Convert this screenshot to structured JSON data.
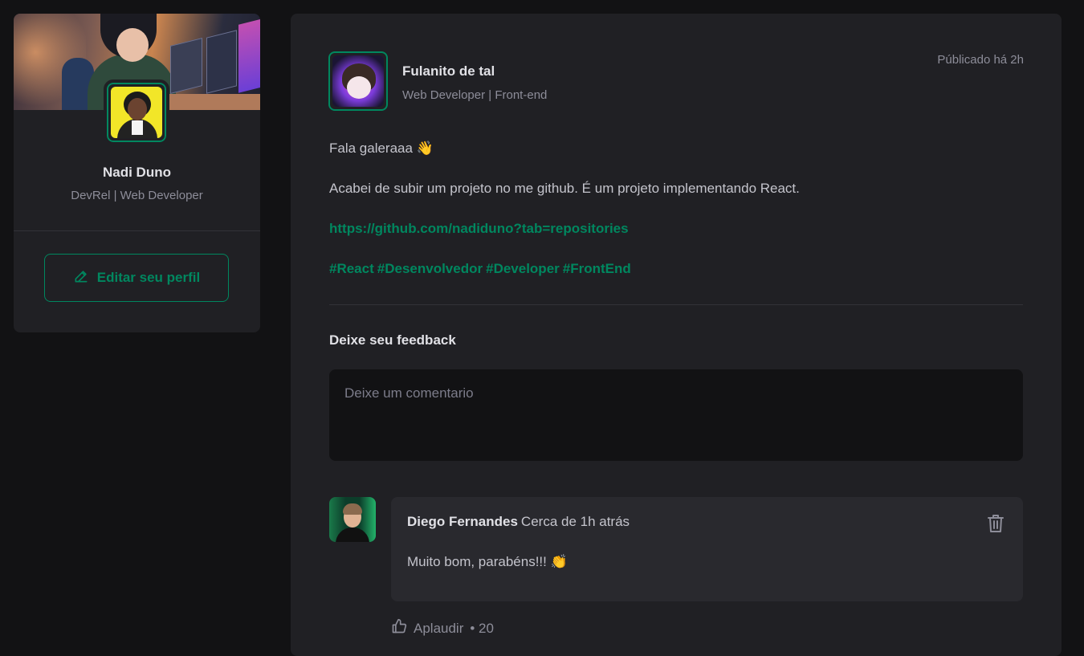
{
  "profile": {
    "name": "Nadi Duno",
    "role": "DevRel | Web Developer",
    "edit_label": "Editar seu perfil"
  },
  "post": {
    "author": {
      "name": "Fulanito de tal",
      "role": "Web Developer | Front-end"
    },
    "published": "Públicado há 2h",
    "content": {
      "greeting": "Fala galeraaa 👋",
      "body": "Acabei de subir um projeto no me github. É um projeto implementando React.",
      "link": "https://github.com/nadiduno?tab=repositories",
      "tags": [
        "#React",
        "#Desenvolvedor",
        "#Developer",
        "#FrontEnd"
      ]
    },
    "feedback": {
      "title": "Deixe seu feedback",
      "placeholder": "Deixe um comentario"
    }
  },
  "comment": {
    "author": "Diego Fernandes",
    "time": "Cerca de 1h atrás",
    "text": "Muito bom, parabéns!!! 👏",
    "applaud_label": "Aplaudir",
    "applaud_count": "• 20"
  },
  "icons": {
    "edit": "pencil-icon",
    "delete": "trash-icon",
    "applaud": "thumbs-up-icon"
  },
  "colors": {
    "background": "#121214",
    "card": "#202024",
    "accent": "#00875f",
    "text": "#e1e1e6",
    "muted": "#8d8d99"
  }
}
